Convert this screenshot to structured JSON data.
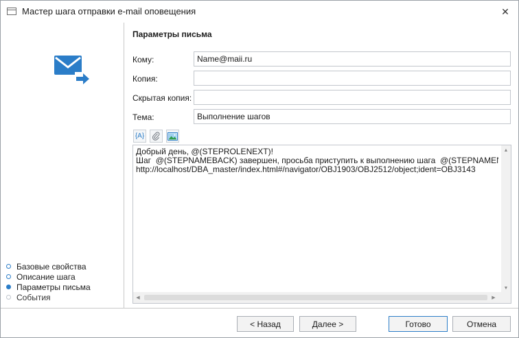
{
  "window": {
    "title": "Мастер шага отправки e-mail оповещения",
    "close_glyph": "✕"
  },
  "sidebar": {
    "icon": "email-send-icon",
    "steps": [
      {
        "label": "Базовые свойства",
        "state": "completed"
      },
      {
        "label": "Описание шага",
        "state": "completed"
      },
      {
        "label": "Параметры письма",
        "state": "active"
      },
      {
        "label": "События",
        "state": "disabled"
      }
    ]
  },
  "form": {
    "section_title": "Параметры письма",
    "to_label": "Кому:",
    "to_value": "Name@maii.ru",
    "cc_label": "Копия:",
    "cc_value": "",
    "bcc_label": "Скрытая копия:",
    "bcc_value": "",
    "subject_label": "Тема:",
    "subject_value": "Выполнение шагов",
    "toolbar": {
      "insert_param_glyph": "{A}",
      "attach_icon": "paperclip-icon",
      "image_icon": "image-icon"
    },
    "body_text": "Добрый день, @(STEPROLENEXT)!\nШаг  @(STEPNAMEBACK) завершен, просьба приступить к выполнению шага  @(STEPNAMENEXT):\nhttp://localhost/DBA_master/index.html#/navigator/OBJ1903/OBJ2512/object;ident=OBJ3143"
  },
  "footer": {
    "back_label": "< Назад",
    "next_label": "Далее >",
    "done_label": "Готово",
    "cancel_label": "Отмена"
  },
  "colors": {
    "accent": "#2b7dc8",
    "border": "#c2c6cc"
  }
}
